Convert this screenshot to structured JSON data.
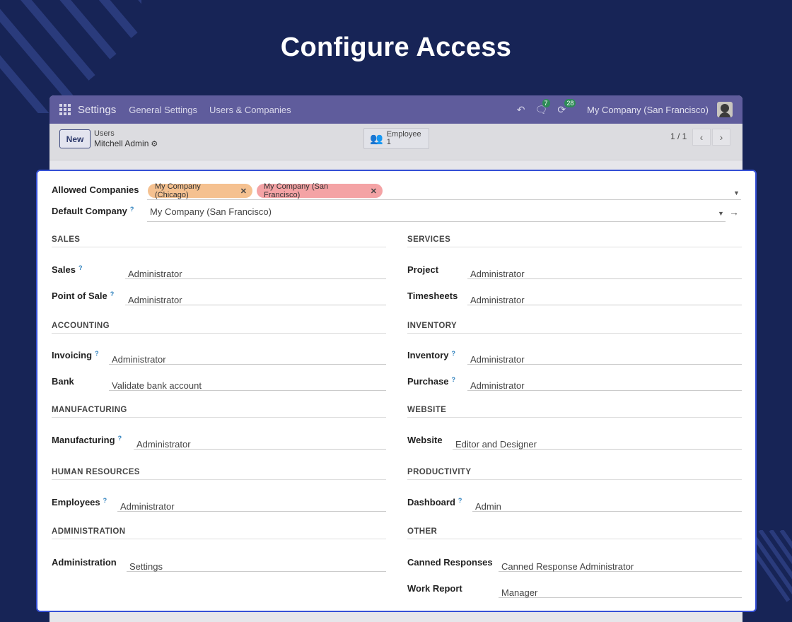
{
  "banner": {
    "title": "Configure Access"
  },
  "app": {
    "navbar": {
      "app_name": "Settings",
      "links": [
        "General Settings",
        "Users & Companies"
      ],
      "messages_count": "7",
      "activities_count": "28",
      "company": "My Company (San Francisco)"
    },
    "control": {
      "new_label": "New",
      "breadcrumb_parent": "Users",
      "breadcrumb_current": "Mitchell Admin",
      "smart_button": {
        "label": "Employee",
        "count": "1"
      },
      "pager": "1 / 1"
    }
  },
  "form": {
    "allowed_companies": {
      "label": "Allowed Companies",
      "tags": [
        {
          "text": "My Company (Chicago)",
          "color": "#f5c190"
        },
        {
          "text": "My Company (San Francisco)",
          "color": "#f4a3a5"
        }
      ]
    },
    "default_company": {
      "label": "Default Company",
      "value": "My Company (San Francisco)"
    },
    "sections": {
      "sales": {
        "title": "SALES",
        "sales_label": "Sales",
        "sales_value": "Administrator",
        "pos_label": "Point of Sale",
        "pos_value": "Administrator"
      },
      "services": {
        "title": "SERVICES",
        "project_label": "Project",
        "project_value": "Administrator",
        "timesheets_label": "Timesheets",
        "timesheets_value": "Administrator"
      },
      "accounting": {
        "title": "ACCOUNTING",
        "invoicing_label": "Invoicing",
        "invoicing_value": "Administrator",
        "bank_label": "Bank",
        "bank_value": "Validate bank account"
      },
      "inventory": {
        "title": "INVENTORY",
        "inventory_label": "Inventory",
        "inventory_value": "Administrator",
        "purchase_label": "Purchase",
        "purchase_value": "Administrator"
      },
      "manufacturing": {
        "title": "MANUFACTURING",
        "manufacturing_label": "Manufacturing",
        "manufacturing_value": "Administrator"
      },
      "website": {
        "title": "WEBSITE",
        "website_label": "Website",
        "website_value": "Editor and Designer"
      },
      "human_resources": {
        "title": "HUMAN RESOURCES",
        "employees_label": "Employees",
        "employees_value": "Administrator"
      },
      "productivity": {
        "title": "PRODUCTIVITY",
        "dashboard_label": "Dashboard",
        "dashboard_value": "Admin"
      },
      "administration": {
        "title": "ADMINISTRATION",
        "administration_label": "Administration",
        "administration_value": "Settings"
      },
      "other": {
        "title": "OTHER",
        "canned_label": "Canned Responses",
        "canned_value": "Canned Response Administrator",
        "work_report_label": "Work Report",
        "work_report_value": "Manager"
      }
    }
  }
}
